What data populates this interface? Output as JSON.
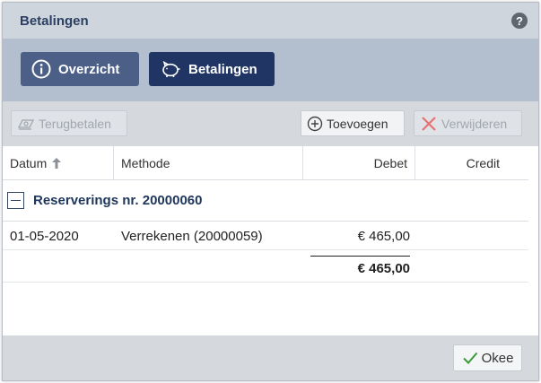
{
  "dialog": {
    "title": "Betalingen",
    "help_icon": "?"
  },
  "tabs": [
    {
      "label": "Overzicht",
      "icon": "info-icon"
    },
    {
      "label": "Betalingen",
      "icon": "piggy-bank-icon"
    }
  ],
  "toolbar": {
    "refund_label": "Terugbetalen",
    "add_label": "Toevoegen",
    "delete_label": "Verwijderen"
  },
  "grid": {
    "columns": [
      "Datum",
      "Methode",
      "Debet",
      "Credit"
    ],
    "group_title": "Reserverings nr. 20000060",
    "rows": [
      {
        "datum": "01-05-2020",
        "methode": "Verrekenen (20000059)",
        "debet": "€ 465,00",
        "credit": ""
      }
    ],
    "total_debet": "€ 465,00"
  },
  "footer": {
    "ok_label": "Okee"
  },
  "colors": {
    "tab_active": "#203563",
    "tab_inactive": "#4b5f87",
    "ok_check": "#3a9a3a",
    "delete_x": "#e57373"
  }
}
